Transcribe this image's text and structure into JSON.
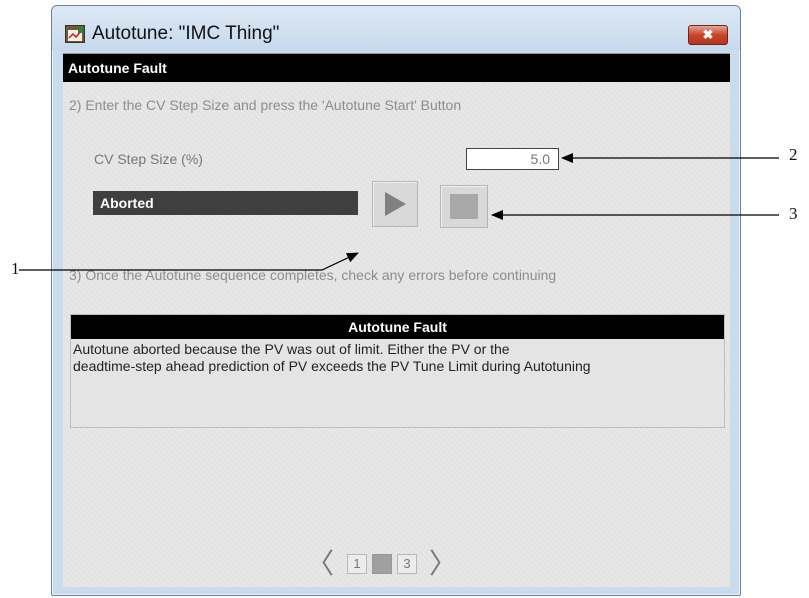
{
  "window": {
    "title": "Autotune: \"IMC Thing\"",
    "close_label": "✖"
  },
  "header": {
    "title": "Autotune Fault"
  },
  "step2": {
    "instruction": "2) Enter the CV Step Size and press the 'Autotune Start' Button",
    "cv_label": "CV Step Size (%)",
    "cv_value": "5.0",
    "status": "Aborted",
    "start_icon": "play-icon",
    "stop_icon": "stop-icon"
  },
  "step3": {
    "instruction": "3) Once the Autotune sequence completes, check any errors before continuing"
  },
  "fault": {
    "title": "Autotune Fault",
    "line1": "Autotune aborted because the PV was out of limit.  Either the PV or the",
    "line2": "deadtime-step ahead prediction of PV exceeds the PV Tune Limit during Autotuning"
  },
  "pager": {
    "prev": "〈",
    "next": "〉",
    "pages": [
      "1",
      "2",
      "3"
    ],
    "current": "2"
  },
  "callouts": {
    "c1": "1",
    "c2": "2",
    "c3": "3"
  },
  "colors": {
    "header_bg": "#000000",
    "status_bg": "#3f3f3f",
    "close_button": "#c7452a",
    "window_frame": "#c9dcee"
  }
}
